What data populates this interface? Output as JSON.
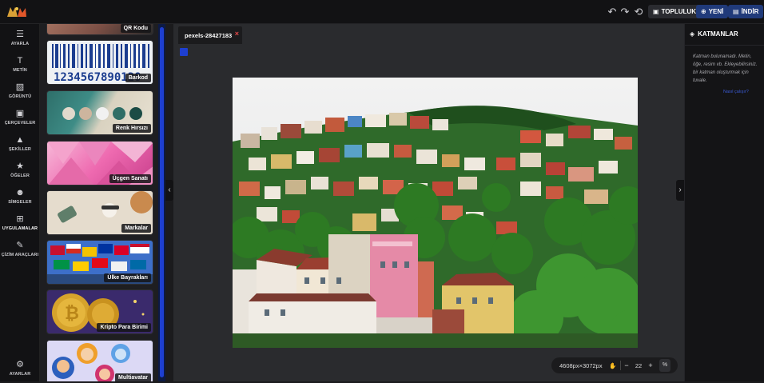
{
  "app": {
    "logo_text": "MKA",
    "top_buttons": {
      "community": "TOPLULUK",
      "new": "YENİ",
      "download": "İNDİR"
    }
  },
  "left_nav": {
    "items": [
      {
        "label": "AYARLA",
        "icon": "sliders-icon"
      },
      {
        "label": "METİN",
        "icon": "text-icon"
      },
      {
        "label": "GÖRÜNTÜ",
        "icon": "image-add-icon"
      },
      {
        "label": "ÇERÇEVELER",
        "icon": "frame-icon"
      },
      {
        "label": "ŞEKİLLER",
        "icon": "shapes-icon"
      },
      {
        "label": "ÖĞELER",
        "icon": "star-icon"
      },
      {
        "label": "SİMGELER",
        "icon": "smiley-icon"
      },
      {
        "label": "UYGULAMALAR",
        "icon": "grid-icon"
      },
      {
        "label": "ÇİZİM ARAÇLARI",
        "icon": "brush-icon"
      }
    ],
    "bottom": {
      "label": "AYARLAR",
      "icon": "gear-icon"
    }
  },
  "apps_panel": {
    "cards": [
      {
        "label": "QR Kodu"
      },
      {
        "label": "Barkod",
        "barcode_digits": "1234567890128"
      },
      {
        "label": "Renk Hırsızı"
      },
      {
        "label": "Üçgen Sanatı"
      },
      {
        "label": "Markalar"
      },
      {
        "label": "Ülke Bayrakları"
      },
      {
        "label": "Kripto Para Birimi"
      },
      {
        "label": "Multiavatar"
      }
    ]
  },
  "canvas": {
    "tab": {
      "filename": "pexels-28427183",
      "close": "×"
    },
    "image_size": "4608px×3072px",
    "zoom": "22",
    "percent": "%"
  },
  "layers_panel": {
    "title": "KATMANLAR",
    "empty_message": "Katman bulunamadı. Metin, öğe, resim vb. Ekleyebilirsiniz. bir katman oluşturmak için tuvale.",
    "link_text": "Nasıl çalışır?"
  },
  "colors": {
    "accent_blue": "#1e3fd0",
    "button_blue": "#203a7a",
    "tab_close": "#e24848"
  }
}
